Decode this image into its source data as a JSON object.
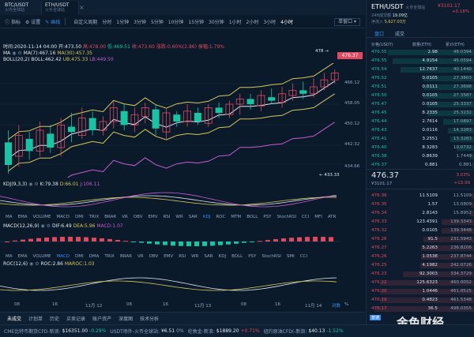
{
  "tabs": [
    {
      "pair": "BTC/USDT",
      "sub": "火币全球站",
      "active": false
    },
    {
      "pair": "ETH/USDT",
      "sub": "火币全球站",
      "active": true
    }
  ],
  "toolbar": {
    "items": [
      {
        "label": "指标",
        "icon": "indicator-icon"
      },
      {
        "label": "设置",
        "icon": "gear-icon"
      },
      {
        "label": "画线",
        "icon": "pencil-icon",
        "selected": true
      }
    ],
    "periods": [
      "自定义周期",
      "分时",
      "1分钟",
      "3分钟",
      "5分钟",
      "10分钟",
      "15分钟",
      "30分钟",
      "1小时",
      "2小时",
      "3小时",
      "4小时"
    ],
    "active_period": "4小时",
    "chart_type": "单窗口"
  },
  "ohlc": {
    "time": "时间:2020-11-14 04:00",
    "open": "开:473.50",
    "high": "高:478.00",
    "low": "低:469.51",
    "close": "收:473.60",
    "change": "涨跌:0.60%(2.86)",
    "amplitude": "振幅:1.79%"
  },
  "ma": {
    "label": "MA",
    "ma7": "MA(7):467.16",
    "ma30": "MA(30):457.35"
  },
  "boll": {
    "label": "BOLL(20,2)",
    "boll": "BOLL:462.42",
    "ub": "UB:475.33",
    "lb": "LB:449.50"
  },
  "price_axis": [
    "466.12",
    "458.05",
    "450.12",
    "442.32",
    "434.66"
  ],
  "current_price_tag": "476.37",
  "high_marker": "478",
  "low_marker": "433.33",
  "kdj": {
    "label": "KDJ(9,3,3)",
    "k": "K:79.38",
    "d": "D:66.01",
    "j": "J:106.11"
  },
  "indicator_tabs_1": [
    "MA",
    "EMA",
    "VOLUME",
    "MACD",
    "DMI",
    "TRIX",
    "BRAR",
    "VR",
    "OBV",
    "EMV",
    "RSI",
    "WR",
    "SAR",
    "KDJ",
    "ROC",
    "MTM",
    "BOLL",
    "PSY",
    "StochRSI",
    "CCI",
    "MFI",
    "ATR"
  ],
  "indicator_tabs_1_active": "KDJ",
  "macd": {
    "label": "MACD(12,26,9)",
    "dif": "DIF:6.49",
    "dea": "DEA:5.96",
    "macd": "MACD:1.07"
  },
  "indicator_tabs_2": [
    "MA",
    "EMA",
    "VOLUME",
    "MACD",
    "DMI",
    "DMA",
    "TRIX",
    "BRAR",
    "VR",
    "OBV",
    "EMV",
    "RSI",
    "WR",
    "SAR",
    "KDJ",
    "BOLL",
    "PSY",
    "StochRSI",
    "SMI",
    "CCI"
  ],
  "indicator_tabs_2_active": "MACD",
  "roc": {
    "label": "ROC(12,6)",
    "roc": "ROC:2.86",
    "marroc": "MAROC:1.03"
  },
  "x_axis": [
    "08",
    "16",
    "11月 12",
    "08",
    "16",
    "11月 13",
    "08",
    "16",
    "11月 14"
  ],
  "x_axis_right": [
    "对数",
    "%"
  ],
  "bottom_tabs": [
    "未成交",
    "计划单",
    "历史",
    "买卖记录",
    "账户资产",
    "深度图",
    "技术分析"
  ],
  "bottom_active": "未成交",
  "ticker": [
    {
      "name": "CME比特币期货CFD-新浪:",
      "value": "$16351.00",
      "change": "-0.29%",
      "dir": "down"
    },
    {
      "name": "USDT场外-火币全球站:",
      "value": "¥6.51",
      "change": "0%",
      "dir": "flat"
    },
    {
      "name": "伦敦金-新浪:",
      "value": "$1889.20",
      "change": "+0.71%",
      "dir": "up"
    },
    {
      "name": "纽约原油CFD(-新浪:",
      "value": "$40.13",
      "change": "-1.52%",
      "dir": "down"
    }
  ],
  "right": {
    "pair": "ETH/USDT",
    "exchange": "火币全球站",
    "price": "¥3101.17",
    "change": "+0.18%",
    "vol_label": "24H成交额",
    "vol": "19.09亿",
    "value_label": "净流入",
    "value": "5,627.03万",
    "tabs": [
      "盘口",
      "成交"
    ],
    "col_headers": [
      "价格(USDT)",
      "数量(ETH)",
      "累计(ETH)"
    ],
    "asks": [
      {
        "p": "476.55",
        "q": "2.98",
        "s": "48.0394",
        "w": 0.85
      },
      {
        "p": "476.55",
        "q": "4.9154",
        "s": "45.0594",
        "w": 0.8
      },
      {
        "p": "476.54",
        "q": "12.7637",
        "s": "40.1440",
        "w": 0.72
      },
      {
        "p": "476.52",
        "q": "0.0105",
        "s": "27.3803",
        "w": 0.5
      },
      {
        "p": "476.51",
        "q": "0.0111",
        "s": "27.3698",
        "w": 0.5
      },
      {
        "p": "476.50",
        "q": "0.0105",
        "s": "27.3587",
        "w": 0.5
      },
      {
        "p": "476.47",
        "q": "0.0105",
        "s": "25.3337",
        "w": 0.46
      },
      {
        "p": "476.45",
        "q": "8.2335",
        "s": "25.3232",
        "w": 0.46
      },
      {
        "p": "476.44",
        "q": "2.7614",
        "s": "17.0897",
        "w": 0.31
      },
      {
        "p": "476.43",
        "q": "0.0116",
        "s": "14.3283",
        "w": 0.26
      },
      {
        "p": "476.41",
        "q": "3.2551",
        "s": "13.3283",
        "w": 0.24
      },
      {
        "p": "476.40",
        "q": "8.3283",
        "s": "10.0732",
        "w": 0.18
      },
      {
        "p": "476.38",
        "q": "0.8639",
        "s": "1.7449",
        "w": 0.05
      },
      {
        "p": "476.37",
        "q": "0.881",
        "s": "0.881",
        "w": 0.02
      }
    ],
    "last_price": "476.37",
    "last_cny": "¥3101.17",
    "last_change_pct": "3.03%",
    "last_change": "+13.99",
    "bids": [
      {
        "p": "476.36",
        "q": "11.5109",
        "s": "11.5109",
        "w": 0.03
      },
      {
        "p": "476.35",
        "q": "1.57",
        "s": "13.0809",
        "w": 0.04
      },
      {
        "p": "476.34",
        "q": "2.8143",
        "s": "15.8952",
        "w": 0.05
      },
      {
        "p": "476.33",
        "q": "123.4391",
        "s": "139.3343",
        "w": 0.32
      },
      {
        "p": "476.32",
        "q": "0.0105",
        "s": "139.3448",
        "w": 0.32
      },
      {
        "p": "476.26",
        "q": "91.5",
        "s": "231.5943",
        "w": 0.5
      },
      {
        "p": "476.27",
        "q": "5.2263",
        "s": "236.8206",
        "w": 0.52
      },
      {
        "p": "476.26",
        "q": "1.0538",
        "s": "237.8744",
        "w": 0.52
      },
      {
        "p": "476.25",
        "q": "4.1982",
        "s": "242.0726",
        "w": 0.53
      },
      {
        "p": "476.23",
        "q": "92.3003",
        "s": "334.3729",
        "w": 0.7
      },
      {
        "p": "476.22",
        "q": "125.6323",
        "s": "460.0052",
        "w": 0.92
      },
      {
        "p": "476.20",
        "q": "1.0446",
        "s": "461.0525",
        "w": 0.92
      },
      {
        "p": "476.19",
        "q": "0.4823",
        "s": "461.5348",
        "w": 0.92
      },
      {
        "p": "476.17",
        "q": "36.5",
        "s": "498.0355",
        "w": 0.98
      }
    ],
    "watermark": "金色财经",
    "badge": "普通"
  },
  "colors": {
    "up": "#e04a5f",
    "down": "#19c4a4",
    "accent": "#3b8ef0",
    "ma7": "#e0e6ee",
    "ma30": "#d8c65a",
    "boll_lb": "#c45cd0"
  }
}
